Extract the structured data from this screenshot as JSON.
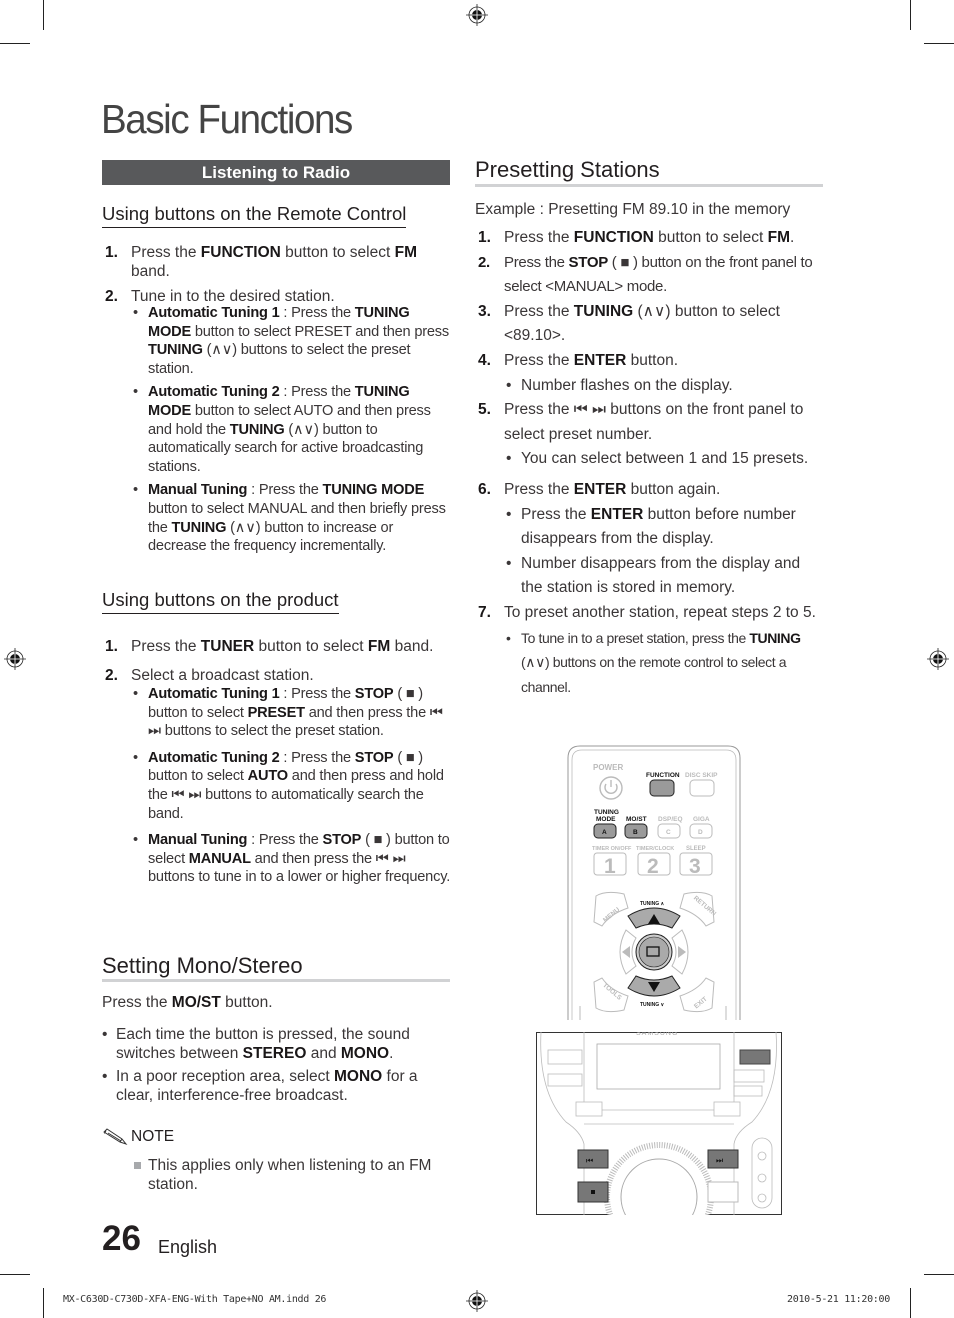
{
  "page": {
    "title": "Basic Functions",
    "page_number": "26",
    "language": "English"
  },
  "left": {
    "section_bar": "Listening to Radio",
    "remote": {
      "heading": "Using buttons on the Remote Control",
      "steps": [
        {
          "num": "1.",
          "pre": "Press the ",
          "b1": "FUNCTION",
          "mid": " button to select ",
          "b2": "FM",
          "post": " band."
        },
        {
          "num": "2.",
          "text": "Tune in to the desired station."
        }
      ],
      "bullets": [
        {
          "label": "Automatic Tuning 1",
          "a": " : Press the ",
          "b1": "TUNING MODE",
          "c": " button to select PRESET and then press ",
          "b2": "TUNING",
          "d": " (∧∨) buttons to select the preset station."
        },
        {
          "label": "Automatic Tuning 2",
          "a": " : Press the ",
          "b1": "TUNING MODE",
          "c": " button to select AUTO and then press and hold the ",
          "b2": "TUNING",
          "d": " (∧∨) button to automatically search for active broadcasting stations."
        },
        {
          "label": "Manual Tuning",
          "a": " : Press the ",
          "b1": "TUNING MODE",
          "c": " button to select MANUAL and then briefly press the ",
          "b2": "TUNING",
          "d": " (∧∨) button to increase or decrease the frequency incrementally."
        }
      ]
    },
    "product": {
      "heading": "Using buttons on the product",
      "steps": [
        {
          "num": "1.",
          "pre": "Press the ",
          "b1": "TUNER",
          "mid": " button to select ",
          "b2": "FM",
          "post": " band."
        },
        {
          "num": "2.",
          "text": "Select a broadcast station."
        }
      ],
      "bullets": [
        {
          "label": "Automatic Tuning 1",
          "a": " : Press the ",
          "b1": "STOP",
          "c": " ( ■ ) button to select ",
          "b2": "PRESET",
          "d": " and then press the ⏮ ⏭ buttons to select the preset station."
        },
        {
          "label": "Automatic Tuning 2",
          "a": " : Press the ",
          "b1": "STOP",
          "c": " ( ■ ) button to select ",
          "b2": "AUTO",
          "d": " and then press and hold the ⏮ ⏭ buttons to automatically search the band."
        },
        {
          "label": "Manual Tuning",
          "a": " : Press the ",
          "b1": "STOP",
          "c": " ( ■ ) button to select ",
          "b2": "MANUAL",
          "d": " and then press the ⏮ ⏭ buttons to tune in to a lower or higher frequency."
        }
      ]
    },
    "mono": {
      "heading": "Setting Mono/Stereo",
      "intro_pre": "Press the ",
      "intro_b": "MO/ST",
      "intro_post": " button.",
      "bullets": [
        {
          "a": "Each time the button is pressed, the sound switches between ",
          "b1": "STEREO",
          "c": " and ",
          "b2": "MONO",
          "d": "."
        },
        {
          "a": "In a poor reception area, select ",
          "b1": "MONO",
          "c": " for a clear, interference-free broadcast.",
          "b2": "",
          "d": ""
        }
      ],
      "note_label": "NOTE",
      "note_text": "This applies only when listening to an FM station."
    }
  },
  "right": {
    "heading": "Presetting Stations",
    "example": "Example : Presetting FM 89.10 in the memory",
    "steps": [
      {
        "num": "1.",
        "html_parts": [
          "Press the ",
          "FUNCTION",
          " button to select ",
          "FM",
          "."
        ]
      },
      {
        "num": "2.",
        "html_parts": [
          "Press the ",
          "STOP",
          " ( ■ ) button on the front panel to select <MANUAL> mode.",
          "",
          ""
        ]
      },
      {
        "num": "3.",
        "html_parts": [
          "Press the ",
          "TUNING",
          " (∧∨) button to select <89.10>.",
          "",
          ""
        ]
      },
      {
        "num": "4.",
        "html_parts": [
          "Press the ",
          "ENTER",
          " button.",
          "",
          ""
        ],
        "subs": [
          [
            "Number flashes on the display.",
            "",
            ""
          ]
        ]
      },
      {
        "num": "5.",
        "html_parts": [
          "Press the ⏮ ⏭ buttons on the front panel to select preset number.",
          "",
          "",
          "",
          ""
        ],
        "subs": [
          [
            "You can select between 1 and 15 presets.",
            "",
            ""
          ]
        ]
      },
      {
        "num": "6.",
        "html_parts": [
          "Press the ",
          "ENTER",
          " button again.",
          "",
          ""
        ],
        "subs": [
          [
            "Press the ",
            "ENTER",
            " button before number disappears from the display."
          ],
          [
            "Number disappears from the display and the station is stored in memory.",
            "",
            ""
          ]
        ]
      },
      {
        "num": "7.",
        "html_parts": [
          "To preset another station, repeat steps 2 to 5.",
          "",
          "",
          "",
          ""
        ],
        "subs": [
          [
            "To tune in to a preset station, press the ",
            "TUNING",
            " (∧∨) buttons on the remote control to select a channel."
          ]
        ]
      }
    ]
  },
  "remote_illustration": {
    "labels": {
      "power": "POWER",
      "function": "FUNCTION",
      "disc_skip": "DISC SKIP",
      "tuning_mode_1": "TUNING",
      "tuning_mode_2": "MODE",
      "most": "MO/ST",
      "dsp_eq": "DSP/EQ",
      "giga": "GIGA",
      "key_a": "A",
      "key_b": "B",
      "key_c": "C",
      "key_d": "D",
      "timer_onoff": "TIMER ON/OFF",
      "timer_clock": "TIMER/CLOCK",
      "sleep": "SLEEP",
      "num1": "1",
      "num2": "2",
      "num3": "3",
      "menu": "MENU",
      "return": "RETURN",
      "tools": "TOOLS",
      "exit": "EXIT",
      "tuning_up": "TUNING ∧",
      "tuning_down": "TUNING ∨"
    }
  },
  "slug": {
    "file": "MX-C630D-C730D-XFA-ENG-With Tape+NO AM.indd   26",
    "datetime": "2010-5-21   11:20:00"
  }
}
